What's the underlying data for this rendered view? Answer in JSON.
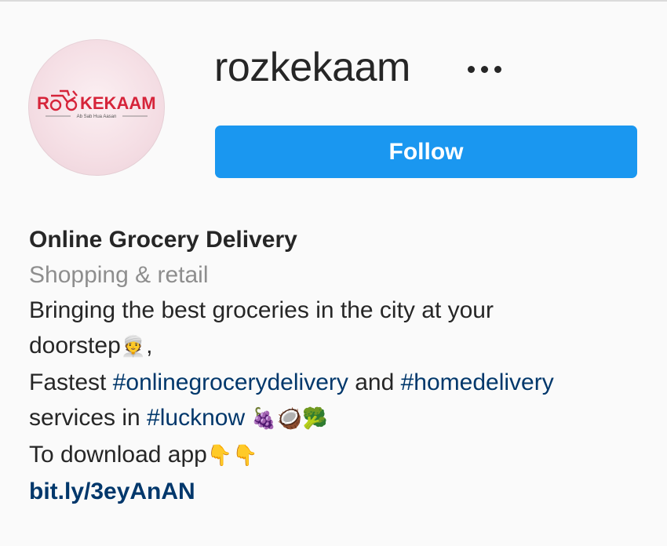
{
  "profile": {
    "username": "rozkekaam",
    "more_label": "•••",
    "follow_label": "Follow",
    "avatar": {
      "logo_text": "KEKAAM",
      "logo_prefix": "R",
      "tagline": "Ab Sab Hua Aasan",
      "brand_color": "#d6243a"
    }
  },
  "bio": {
    "display_name": "Online Grocery Delivery",
    "category": "Shopping & retail",
    "line1": "Bringing the best groceries in the city at your",
    "line2_text": "doorstep",
    "line2_emoji": "👳",
    "line2_suffix": ",",
    "line3_prefix": "Fastest ",
    "hashtag_1": "#onlinegrocerydelivery",
    "line3_mid": " and ",
    "hashtag_2": "#homedelivery",
    "line4_prefix": "services in ",
    "hashtag_3": "#lucknow",
    "line4_emojis": " 🍇🥥🥦",
    "line5_text": "To download app",
    "line5_emojis": "👇👇",
    "link": "bit.ly/3eyAnAN"
  },
  "colors": {
    "follow_button": "#1a97f0",
    "hashtag": "#00376b",
    "category": "#8e8e8e",
    "text": "#262626",
    "background": "#fafafa"
  }
}
